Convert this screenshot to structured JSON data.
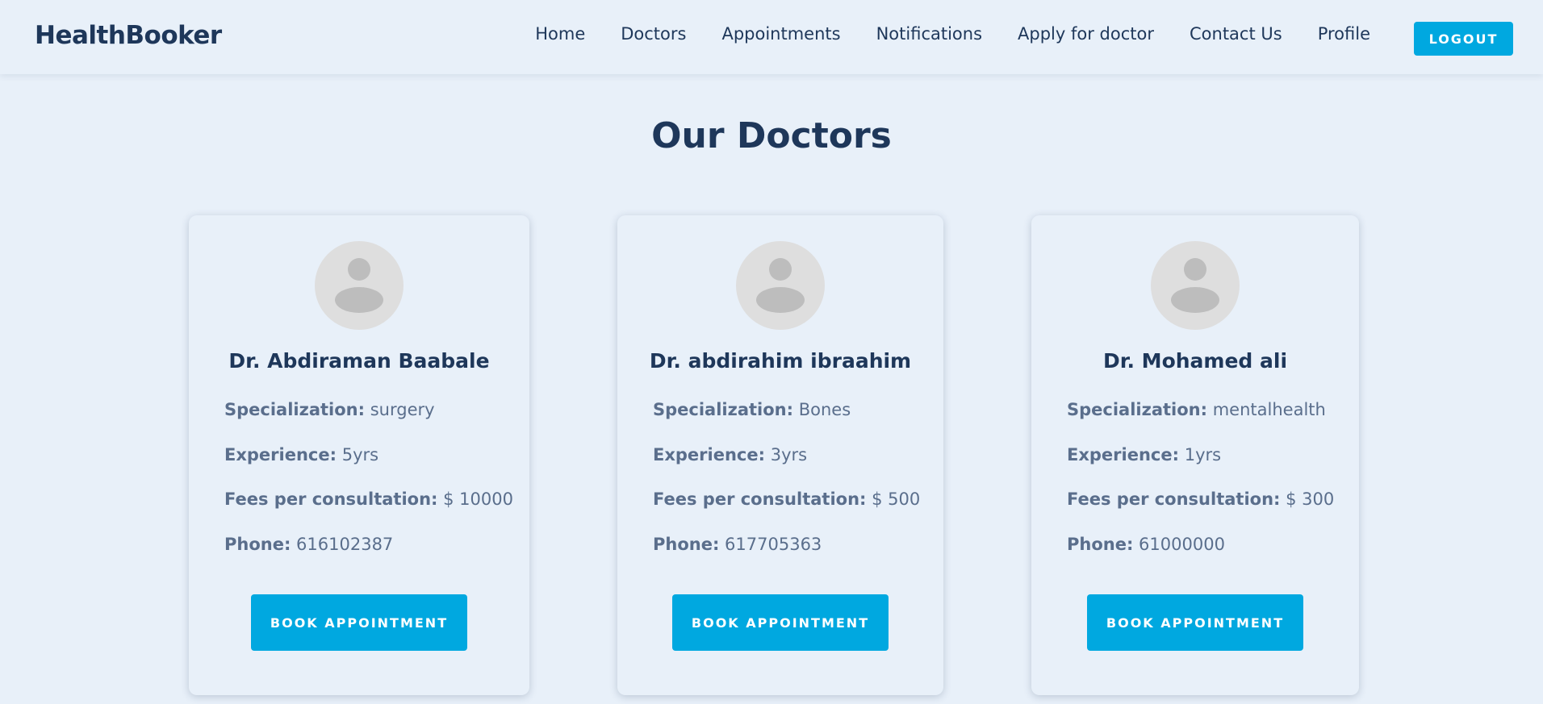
{
  "header": {
    "brand": "HealthBooker",
    "nav": [
      {
        "label": "Home"
      },
      {
        "label": "Doctors"
      },
      {
        "label": "Appointments"
      },
      {
        "label": "Notifications"
      },
      {
        "label": "Apply for doctor"
      },
      {
        "label": "Contact Us"
      },
      {
        "label": "Profile"
      }
    ],
    "logout_label": "LOGOUT"
  },
  "main": {
    "title": "Our Doctors",
    "labels": {
      "specialization": "Specialization:",
      "experience": "Experience:",
      "fees": "Fees per consultation:",
      "phone": "Phone:"
    },
    "book_label": "BOOK APPOINTMENT",
    "doctors": [
      {
        "name": "Dr. Abdiraman Baabale",
        "specialization": "surgery",
        "experience": "5yrs",
        "fees": "$ 10000",
        "phone": "616102387"
      },
      {
        "name": "Dr. abdirahim ibraahim",
        "specialization": "Bones",
        "experience": "3yrs",
        "fees": "$ 500",
        "phone": "617705363"
      },
      {
        "name": "Dr. Mohamed ali",
        "specialization": "mentalhealth",
        "experience": "1yrs",
        "fees": "$ 300",
        "phone": "61000000"
      }
    ]
  },
  "colors": {
    "background": "#e8f0f9",
    "primary_text": "#1e375a",
    "secondary_text": "#5a6e8c",
    "accent": "#00a8e0",
    "avatar_bg": "#dedede",
    "avatar_fg": "#bdbdbd"
  },
  "icons": {
    "avatar": "user-avatar-icon"
  }
}
